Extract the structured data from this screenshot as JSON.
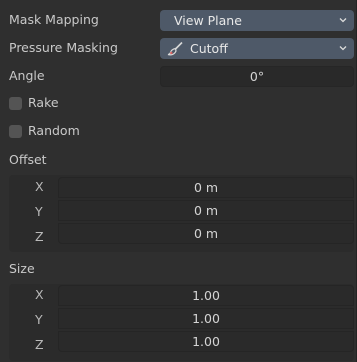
{
  "mask_mapping": {
    "label": "Mask Mapping",
    "value": "View Plane"
  },
  "pressure_masking": {
    "label": "Pressure Masking",
    "value": "Cutoff",
    "icon": "brush-icon"
  },
  "angle": {
    "label": "Angle",
    "value": "0°"
  },
  "rake": {
    "label": "Rake",
    "checked": false
  },
  "random": {
    "label": "Random",
    "checked": false
  },
  "offset": {
    "label": "Offset",
    "rows": [
      {
        "axis": "X",
        "value": "0 m"
      },
      {
        "axis": "Y",
        "value": "0 m"
      },
      {
        "axis": "Z",
        "value": "0 m"
      }
    ]
  },
  "size": {
    "label": "Size",
    "rows": [
      {
        "axis": "X",
        "value": "1.00"
      },
      {
        "axis": "Y",
        "value": "1.00"
      },
      {
        "axis": "Z",
        "value": "1.00"
      }
    ]
  },
  "colors": {
    "panel_bg": "#2f2f2f",
    "dropdown_bg": "#4e5968",
    "field_bg": "#292929",
    "checkbox_bg": "#545454"
  }
}
